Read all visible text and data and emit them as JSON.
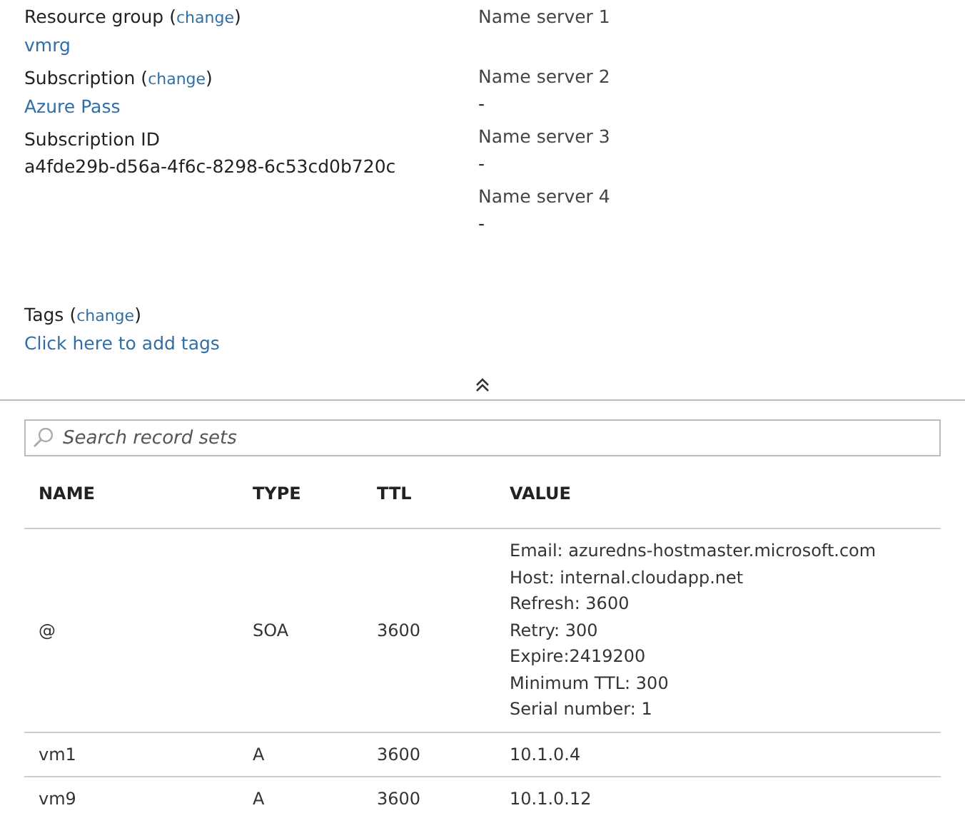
{
  "essentials": {
    "left": [
      {
        "label": "Resource group",
        "open": "(",
        "action": "change",
        "close": ")",
        "value": "vmrg",
        "kind": "link"
      },
      {
        "label": "Subscription",
        "open": "(",
        "action": "change",
        "close": ")",
        "value": "Azure Pass",
        "kind": "link"
      },
      {
        "label": "Subscription ID",
        "value": "a4fde29b-d56a-4f6c-8298-6c53cd0b720c",
        "kind": "text"
      }
    ],
    "right": [
      {
        "label": "Name server 1"
      },
      {
        "label": "Name server 2",
        "value": "-"
      },
      {
        "label": "Name server 3",
        "value": "-"
      },
      {
        "label": "Name server 4",
        "value": "-"
      }
    ],
    "tags": {
      "label": "Tags",
      "open": "(",
      "action": "change",
      "close": ")",
      "value": "Click here to add tags"
    }
  },
  "search": {
    "placeholder": "Search record sets"
  },
  "table": {
    "columns": [
      "NAME",
      "TYPE",
      "TTL",
      "VALUE"
    ],
    "rows": [
      {
        "name": "@",
        "type": "SOA",
        "ttl": "3600",
        "value": [
          "Email: azuredns-hostmaster.microsoft.com",
          "Host: internal.cloudapp.net",
          "Refresh: 3600",
          "Retry: 300",
          "Expire:2419200",
          "Minimum TTL: 300",
          "Serial number: 1"
        ]
      },
      {
        "name": "vm1",
        "type": "A",
        "ttl": "3600",
        "value": [
          "10.1.0.4"
        ]
      },
      {
        "name": "vm9",
        "type": "A",
        "ttl": "3600",
        "value": [
          "10.1.0.12"
        ]
      }
    ]
  }
}
